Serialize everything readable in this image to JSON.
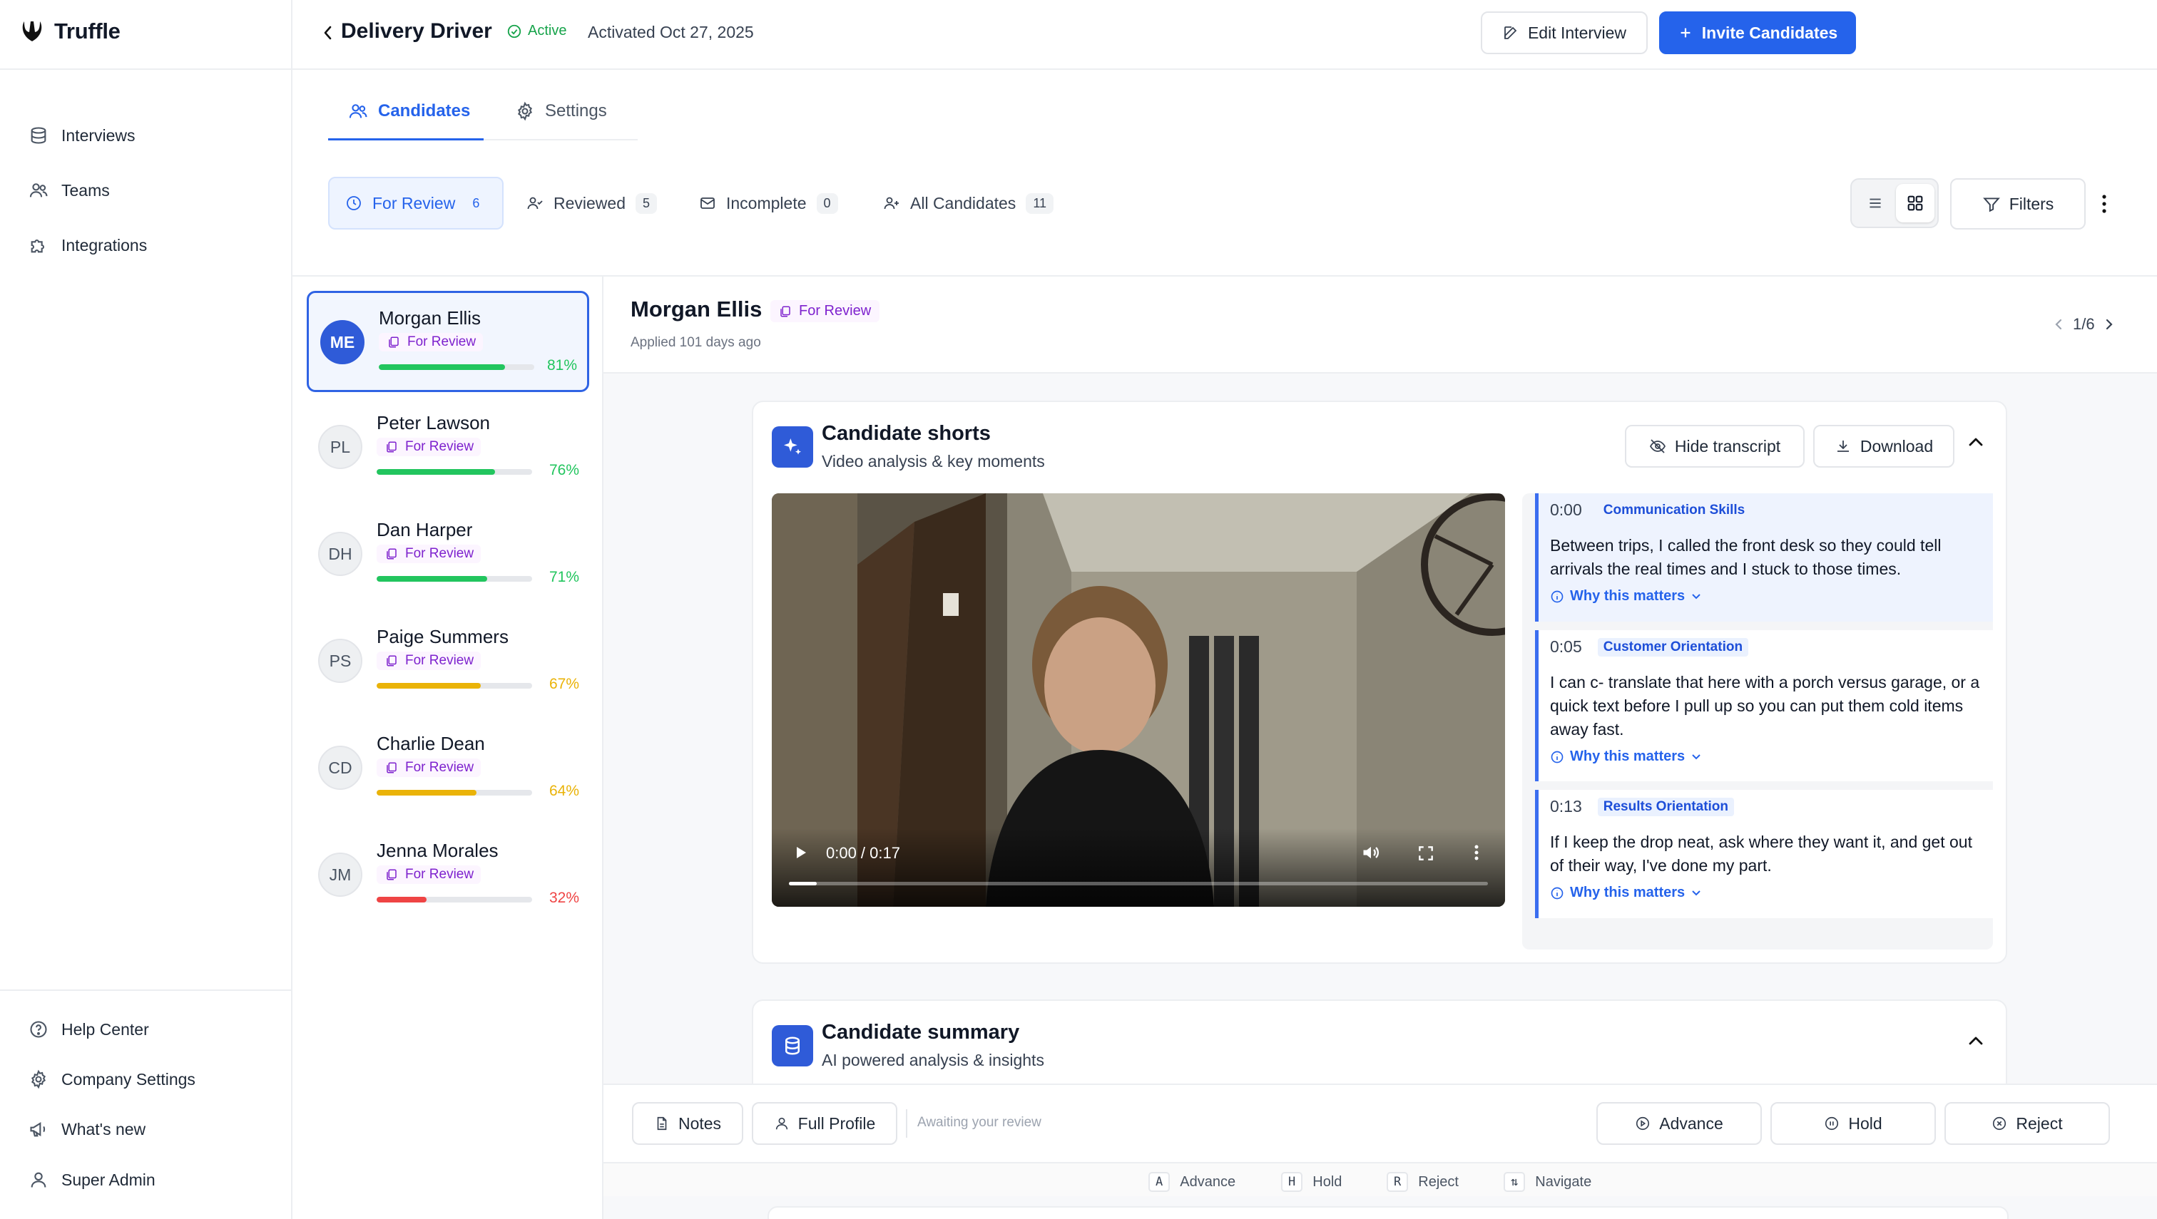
{
  "brand": {
    "name": "Truffle"
  },
  "sidebar": {
    "nav": [
      {
        "label": "Interviews",
        "icon": "database-icon"
      },
      {
        "label": "Teams",
        "icon": "users-icon"
      },
      {
        "label": "Integrations",
        "icon": "puzzle-icon"
      }
    ],
    "bottom": [
      {
        "label": "Help Center",
        "icon": "help-icon"
      },
      {
        "label": "Company Settings",
        "icon": "gear-icon"
      },
      {
        "label": "What's new",
        "icon": "megaphone-icon"
      },
      {
        "label": "Super Admin",
        "icon": "user-icon"
      }
    ]
  },
  "header": {
    "title": "Delivery Driver",
    "status": "Active",
    "activated": "Activated Oct 27, 2025",
    "edit_label": "Edit Interview",
    "invite_label": "Invite Candidates"
  },
  "tabs": {
    "candidates": "Candidates",
    "settings": "Settings"
  },
  "filters": {
    "for_review": {
      "label": "For Review",
      "count": "6"
    },
    "reviewed": {
      "label": "Reviewed",
      "count": "5"
    },
    "incomplete": {
      "label": "Incomplete",
      "count": "0"
    },
    "all": {
      "label": "All Candidates",
      "count": "11"
    },
    "filters_label": "Filters"
  },
  "candidates": [
    {
      "initials": "ME",
      "name": "Morgan Ellis",
      "status": "For Review",
      "score_text": "81%",
      "score": 81,
      "color": "#22c55e",
      "selected": true
    },
    {
      "initials": "PL",
      "name": "Peter Lawson",
      "status": "For Review",
      "score_text": "76%",
      "score": 76,
      "color": "#22c55e"
    },
    {
      "initials": "DH",
      "name": "Dan Harper",
      "status": "For Review",
      "score_text": "71%",
      "score": 71,
      "color": "#22c55e"
    },
    {
      "initials": "PS",
      "name": "Paige Summers",
      "status": "For Review",
      "score_text": "67%",
      "score": 67,
      "color": "#eab308"
    },
    {
      "initials": "CD",
      "name": "Charlie Dean",
      "status": "For Review",
      "score_text": "64%",
      "score": 64,
      "color": "#eab308"
    },
    {
      "initials": "JM",
      "name": "Jenna Morales",
      "status": "For Review",
      "score_text": "32%",
      "score": 32,
      "color": "#ef4444"
    }
  ],
  "detail": {
    "name": "Morgan Ellis",
    "status": "For Review",
    "applied": "Applied 101 days ago",
    "pager": "1/6"
  },
  "shorts": {
    "title": "Candidate shorts",
    "subtitle": "Video analysis & key moments",
    "hide_transcript": "Hide transcript",
    "download": "Download",
    "video_time": "0:00 / 0:17",
    "progress": 0.04,
    "segments": [
      {
        "time": "0:00",
        "tag": "Communication Skills",
        "text": "Between trips, I called the front desk so they could tell arrivals the real times and I stuck to those times.",
        "why": "Why this matters"
      },
      {
        "time": "0:05",
        "tag": "Customer Orientation",
        "text": "I can c- translate that here with a porch versus garage, or a quick text before I pull up so you can put them cold items away fast.",
        "why": "Why this matters"
      },
      {
        "time": "0:13",
        "tag": "Results Orientation",
        "text": "If I keep the drop neat, ask where they want it, and get out of their way, I've done my part.",
        "why": "Why this matters"
      }
    ]
  },
  "summary": {
    "title": "Candidate summary",
    "subtitle": "AI powered analysis & insights"
  },
  "actions": {
    "notes": "Notes",
    "full_profile": "Full Profile",
    "awaiting": "Awaiting your review",
    "advance": "Advance",
    "hold": "Hold",
    "reject": "Reject"
  },
  "shortcuts": [
    {
      "key": "A",
      "label": "Advance"
    },
    {
      "key": "H",
      "label": "Hold"
    },
    {
      "key": "R",
      "label": "Reject"
    },
    {
      "key": "⇅",
      "label": "Navigate"
    }
  ]
}
